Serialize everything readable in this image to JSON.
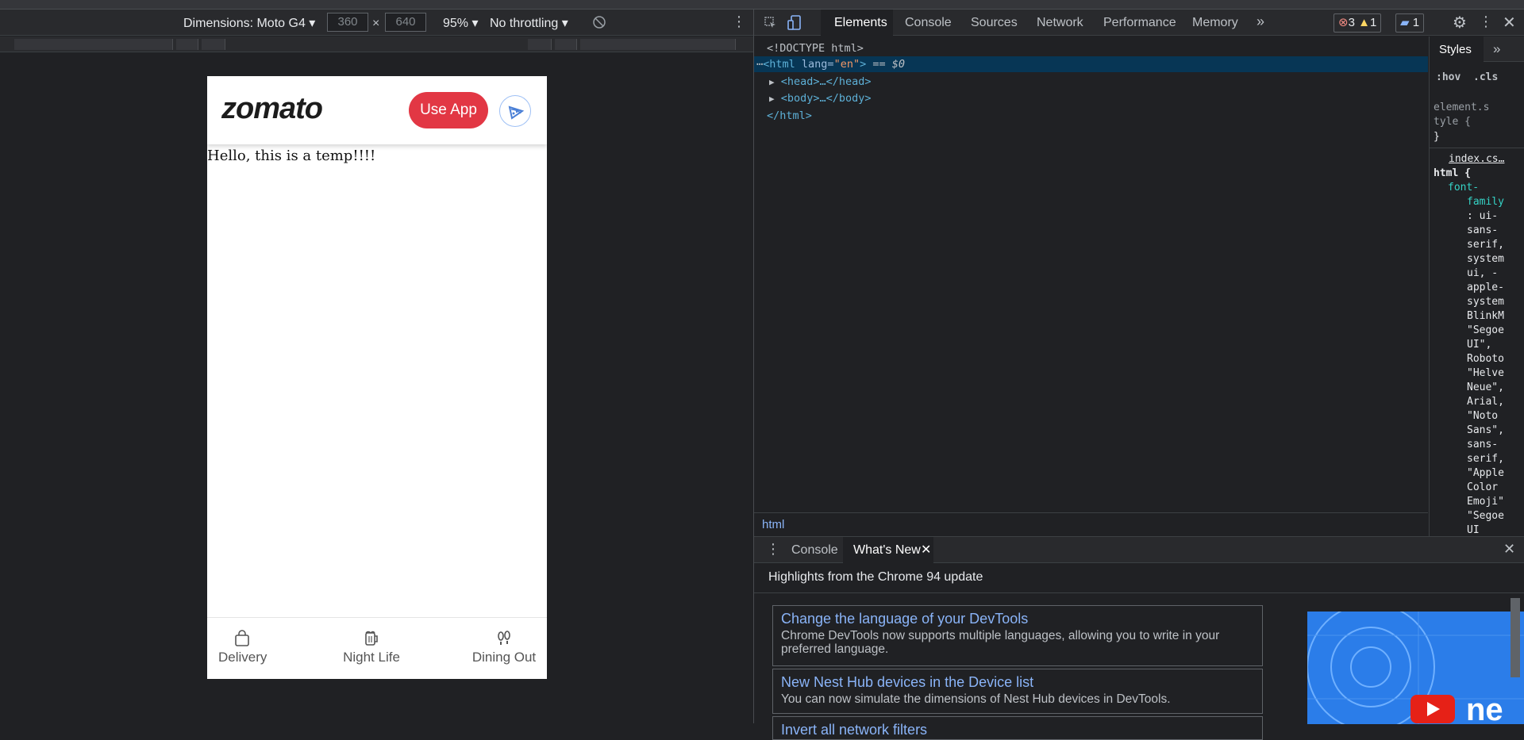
{
  "device_toolbar": {
    "dimensions_label": "Dimensions: Moto G4",
    "width_value": "360",
    "height_value": "640",
    "times": "×",
    "zoom": "95%",
    "throttle": "No throttling"
  },
  "phone": {
    "logo": "zomato",
    "use_app": "Use App",
    "body_text": "Hello, this is a temp!!!!",
    "nav": [
      {
        "label": "Delivery",
        "icon": "shopping-bag-icon"
      },
      {
        "label": "Night Life",
        "icon": "beer-mug-icon"
      },
      {
        "label": "Dining Out",
        "icon": "footprints-icon"
      }
    ]
  },
  "devtools": {
    "tabs": [
      "Elements",
      "Console",
      "Sources",
      "Network",
      "Performance",
      "Memory"
    ],
    "more": "»",
    "errors": "3",
    "warnings": "1",
    "messages": "1",
    "dom": {
      "doctype": "<!DOCTYPE html>",
      "html_open_tag": "<html",
      "html_attr_name": " lang=",
      "html_attr_value": "\"en\"",
      "html_close_bracket": ">",
      "html_suffix": " == $0",
      "head": "<head>…</head>",
      "body": "<body>…</body>",
      "html_close": "</html>"
    },
    "breadcrumb": "html",
    "styles": {
      "tab": "Styles",
      "hov": ":hov",
      "cls": ".cls",
      "element_style_1": "element.s",
      "element_style_2": "tyle {",
      "close_brace": "}",
      "source": "index.cs…",
      "selector": "html {",
      "prop_1": "font-",
      "prop_2": "family",
      "values": [
        ": ui-",
        "sans-",
        "serif,",
        "system",
        "ui, -",
        "apple-",
        "system",
        "BlinkM",
        "\"Segoe",
        "UI\",",
        "Roboto",
        "\"Helve",
        "Neue\",",
        "Arial,",
        "\"Noto",
        "Sans\",",
        "sans-",
        "serif,",
        "\"Apple",
        "Color",
        "Emoji\"",
        "\"Segoe",
        "UI"
      ]
    },
    "drawer": {
      "tabs": [
        "Console",
        "What's New"
      ],
      "highlights": "Highlights from the Chrome 94 update",
      "cards": [
        {
          "title": "Change the language of your DevTools",
          "desc": "Chrome DevTools now supports multiple languages, allowing you to write in your preferred language."
        },
        {
          "title": "New Nest Hub devices in the Device list",
          "desc": "You can now simulate the dimensions of Nest Hub devices in DevTools."
        },
        {
          "title": "Invert all network filters",
          "desc": ""
        }
      ],
      "promo_text": "ne"
    }
  },
  "colors": {
    "brand_red": "#e23744",
    "link_blue": "#8ab4f8",
    "selection": "#073655"
  }
}
